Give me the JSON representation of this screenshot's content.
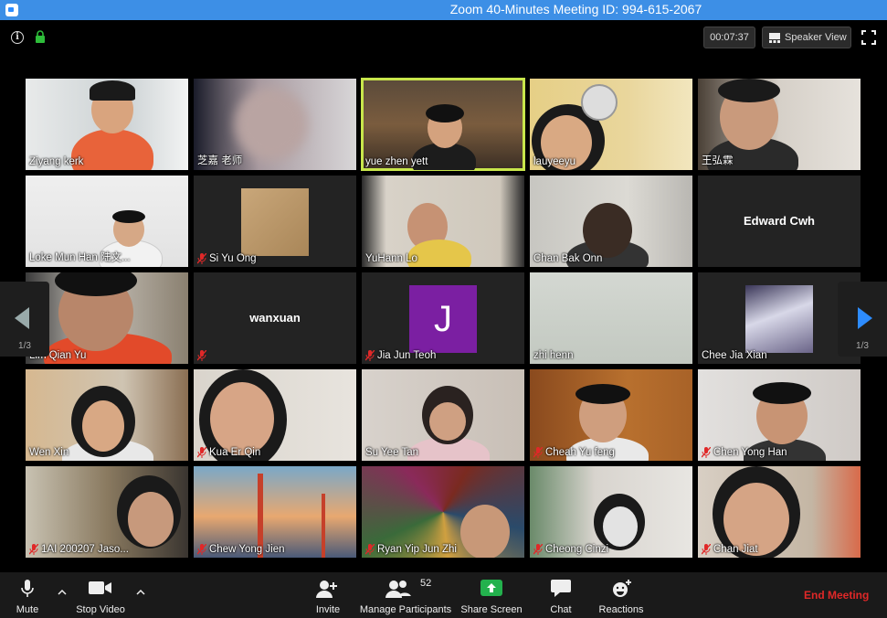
{
  "window": {
    "title": "Zoom 40-Minutes Meeting ID: 994-615-2067"
  },
  "topbar": {
    "timer": "00:07:37",
    "speaker_view_label": "Speaker View",
    "icons": [
      "info-icon",
      "lock-icon",
      "grid-icon",
      "fullscreen-icon"
    ]
  },
  "navigation": {
    "prev_page": "1/3",
    "next_page": "1/3"
  },
  "tiles": [
    {
      "name": "Ziyang kerk",
      "muted": false,
      "active": false
    },
    {
      "name": "芝嘉 老师",
      "muted": false,
      "active": false
    },
    {
      "name": "yue zhen yett",
      "muted": false,
      "active": true
    },
    {
      "name": "lauyeeyu",
      "muted": false,
      "active": false
    },
    {
      "name": "王弘霖",
      "muted": false,
      "active": false
    },
    {
      "name": "Loke Mun Han 陆文...",
      "muted": false,
      "active": false
    },
    {
      "name": "Si Yu Ong",
      "muted": true,
      "active": false
    },
    {
      "name": "YuHann Lo",
      "muted": false,
      "active": false
    },
    {
      "name": "Chan Bak Onn",
      "muted": false,
      "active": false
    },
    {
      "name": "",
      "center_name": "Edward Cwh",
      "muted": false,
      "active": false
    },
    {
      "name": "Lim Qian Yu",
      "muted": false,
      "active": false
    },
    {
      "name": "",
      "center_name": "wanxuan",
      "muted": true,
      "active": false
    },
    {
      "name": "Jia Jun Teoh",
      "avatar_letter": "J",
      "muted": true,
      "active": false
    },
    {
      "name": "zhi henn",
      "muted": false,
      "active": false
    },
    {
      "name": "Chee Jia Xian",
      "muted": false,
      "active": false
    },
    {
      "name": "Wen Xin",
      "muted": false,
      "active": false
    },
    {
      "name": "Kua Er Qin",
      "muted": true,
      "active": false
    },
    {
      "name": "Su Yee Tan",
      "muted": false,
      "active": false
    },
    {
      "name": "Cheah Yu feng",
      "muted": true,
      "active": false
    },
    {
      "name": "Chen Yong Han",
      "muted": true,
      "active": false
    },
    {
      "name": "1AI 200207 Jaso...",
      "muted": true,
      "active": false
    },
    {
      "name": "Chew Yong Jien",
      "muted": true,
      "active": false
    },
    {
      "name": "Ryan Yip Jun Zhi",
      "muted": true,
      "active": false
    },
    {
      "name": "Cheong Cinzi",
      "muted": true,
      "active": false
    },
    {
      "name": "Chan Jiat",
      "muted": true,
      "active": false
    }
  ],
  "toolbar": {
    "mute_label": "Mute",
    "stop_video_label": "Stop Video",
    "invite_label": "Invite",
    "manage_participants_label": "Manage Participants",
    "participant_count": "52",
    "share_screen_label": "Share Screen",
    "chat_label": "Chat",
    "reactions_label": "Reactions",
    "end_meeting_label": "End Meeting"
  },
  "colors": {
    "titlebar": "#3d8fe6",
    "active_speaker": "#c8e64b",
    "share_green": "#23b14d",
    "end_meeting": "#e02828",
    "muted_red": "#e02828"
  }
}
